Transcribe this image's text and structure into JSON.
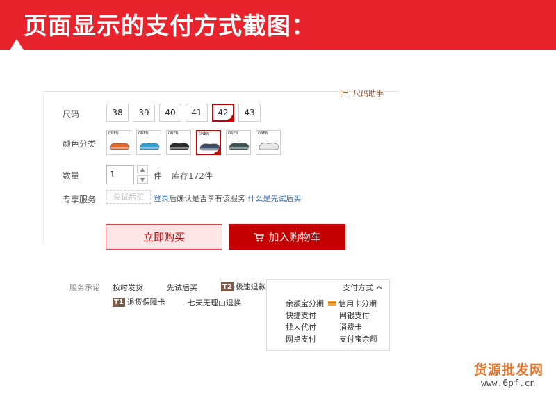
{
  "banner": {
    "title": "页面显示的支付方式截图："
  },
  "size_helper": {
    "label": "尺码助手"
  },
  "size": {
    "label": "尺码",
    "options": [
      "38",
      "39",
      "40",
      "41",
      "42",
      "43"
    ],
    "selected": "42"
  },
  "color": {
    "label": "颜色分类",
    "swatch_tag": "ONEN",
    "swatches": [
      {
        "name": "orange",
        "color": "#e2652c"
      },
      {
        "name": "light-blue",
        "color": "#2f9fd4"
      },
      {
        "name": "black",
        "color": "#2b2b2b"
      },
      {
        "name": "navy",
        "color": "#3a4a66"
      },
      {
        "name": "dark-teal",
        "color": "#3d5656"
      },
      {
        "name": "white",
        "color": "#e8e8e8"
      }
    ],
    "selected_index": 3
  },
  "quantity": {
    "label": "数量",
    "value": "1",
    "unit": "件",
    "stock": "库存172件"
  },
  "service": {
    "label": "专享服务",
    "try_first_button": "先试后买",
    "login_link": "登录",
    "description": "后确认是否享有该服务",
    "what_is_link": "什么是先试后买"
  },
  "actions": {
    "buy_now": "立即购买",
    "add_to_cart": "加入购物车"
  },
  "promises": {
    "label": "服务承诺",
    "items": [
      "按时发货",
      "先试后买",
      "极速退款",
      "退货保障卡",
      "七天无理由退换"
    ],
    "badge_t2": "T2",
    "badge_t1": "T1"
  },
  "payment": {
    "header": "支付方式",
    "methods": [
      "余额宝分期",
      "信用卡分期",
      "快捷支付",
      "网银支付",
      "找人代付",
      "消费卡",
      "网点支付",
      "支付宝余额"
    ]
  },
  "watermark": {
    "site_name": "货源批发网",
    "url": "www.6pf.cn"
  },
  "colors": {
    "brand_red": "#e8232b",
    "button_red": "#c40000",
    "link_blue": "#3c6fb5"
  }
}
